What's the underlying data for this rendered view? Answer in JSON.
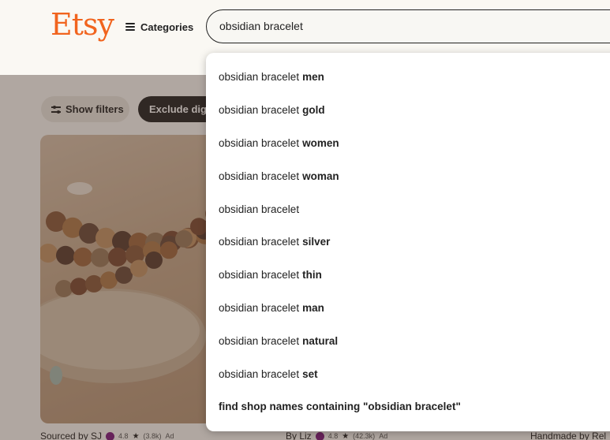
{
  "header": {
    "logo": "Etsy",
    "categories_label": "Categories",
    "search_value": "obsidian bracelet"
  },
  "filters": {
    "show_filters": "Show filters",
    "exclude_digital": "Exclude digi"
  },
  "products": [
    {
      "seller": "Sourced by SJ",
      "rating": "4.8",
      "reviews": "(3.8k)",
      "ad": "Ad"
    },
    {
      "seller": "By Liz",
      "rating": "4.8",
      "reviews": "(42.3k)",
      "ad": "Ad"
    },
    {
      "seller": "Handmade by Rel"
    }
  ],
  "suggestions": [
    {
      "base": "obsidian bracelet",
      "suffix": "men"
    },
    {
      "base": "obsidian bracelet",
      "suffix": "gold"
    },
    {
      "base": "obsidian bracelet",
      "suffix": "women"
    },
    {
      "base": "obsidian bracelet",
      "suffix": "woman"
    },
    {
      "base": "obsidian bracelet",
      "suffix": ""
    },
    {
      "base": "obsidian bracelet",
      "suffix": "silver"
    },
    {
      "base": "obsidian bracelet",
      "suffix": "thin"
    },
    {
      "base": "obsidian bracelet",
      "suffix": "man"
    },
    {
      "base": "obsidian bracelet",
      "suffix": "natural"
    },
    {
      "base": "obsidian bracelet",
      "suffix": "set"
    }
  ],
  "shop_search": "find shop names containing \"obsidian bracelet\"",
  "colors": {
    "brand": "#f1641e",
    "overlay": "rgba(70,50,40,0.42)"
  }
}
